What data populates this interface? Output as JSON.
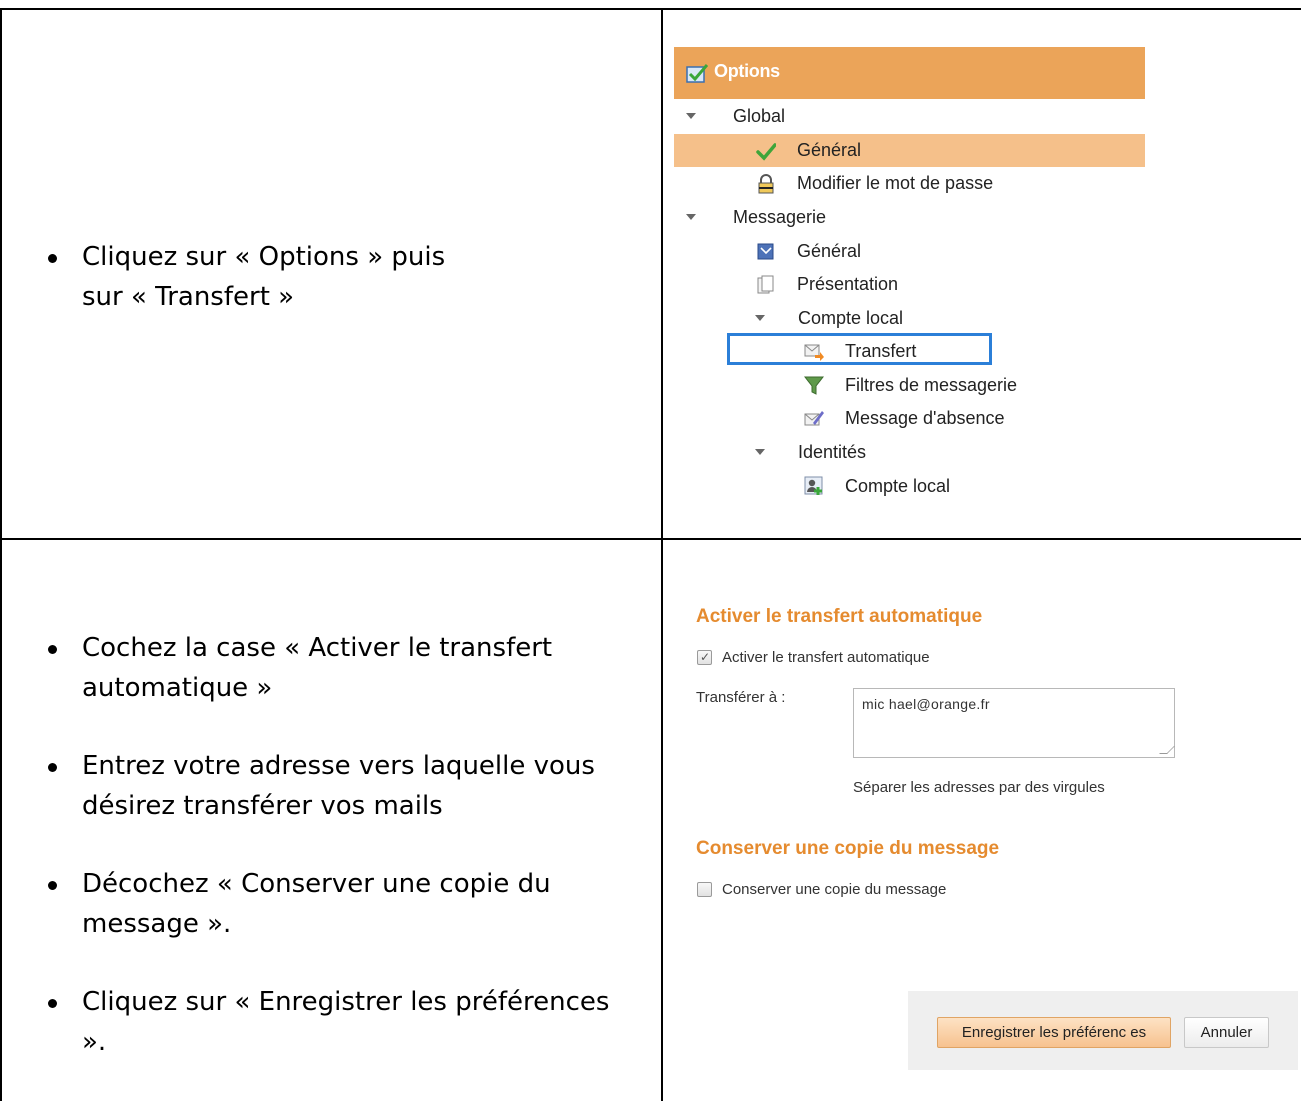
{
  "instructions_top": {
    "items": [
      "Cliquez sur « Options » puis sur « Transfert »"
    ]
  },
  "instructions_bottom": {
    "items": [
      "Cochez la case « Activer le transfert automatique »",
      "Entrez votre adresse vers laquelle vous désirez transférer vos mails",
      "Décochez « Conserver une copie du message ».",
      "Cliquez sur « Enregistrer les préférences »."
    ]
  },
  "options_panel": {
    "title": "Options",
    "title_icon": "checklist-icon",
    "header_color": "#eba459",
    "selected_color": "#f5c08a",
    "highlight_color": "#2b7fd8",
    "tree": [
      {
        "label": "Global",
        "type": "group"
      },
      {
        "label": "Général",
        "icon": "green-check-icon",
        "selected": true
      },
      {
        "label": "Modifier le mot de passe",
        "icon": "padlock-icon"
      },
      {
        "label": "Messagerie",
        "type": "group"
      },
      {
        "label": "Général",
        "icon": "mail-settings-icon"
      },
      {
        "label": "Présentation",
        "icon": "pages-icon"
      },
      {
        "label": "Compte local",
        "type": "group"
      },
      {
        "label": "Transfert",
        "icon": "forward-mail-icon",
        "highlighted": true
      },
      {
        "label": "Filtres de messagerie",
        "icon": "funnel-icon"
      },
      {
        "label": "Message d'absence",
        "icon": "absence-mail-icon"
      },
      {
        "label": "Identités",
        "type": "group"
      },
      {
        "label": "Compte local",
        "icon": "user-add-icon"
      }
    ]
  },
  "transfer_form": {
    "section1_title": "Activer le transfert automatique",
    "auto_forward_checkbox": {
      "label": "Activer le transfert automatique",
      "checked": true
    },
    "forward_to_label": "Transférer à :",
    "forward_to_value": "mic hael@orange.fr",
    "hint": "Séparer les adresses par des virgules",
    "section2_title": "Conserver une copie du message",
    "keep_copy_checkbox": {
      "label": "Conserver une copie du message",
      "checked": false
    },
    "save_button": "Enregistrer les préférenc es",
    "cancel_button": "Annuler",
    "accent_color": "#e58b2f"
  }
}
